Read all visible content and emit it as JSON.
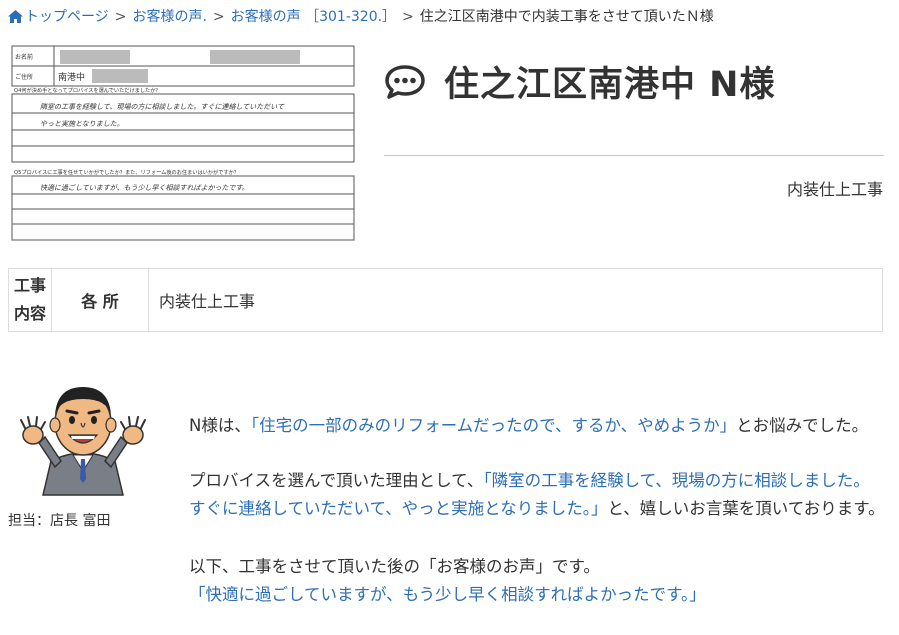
{
  "breadcrumb": {
    "home": "トップページ",
    "sep": ">",
    "items": [
      "お客様の声.",
      "お客様の声 ［301-320.］"
    ],
    "current": "住之江区南港中で内装工事をさせて頂いたＮ様"
  },
  "survey": {
    "name_label": "お名前",
    "address_label": "ご住所",
    "address_value": "南港中",
    "q4": "Q4何が決め手となってプロバイスを選んでいただけましたか？",
    "a4_line1": "隣室の工事を経験して、現場の方に相談しました。すぐに連絡していただいて",
    "a4_line2": "やっと実施となりました。",
    "q5": "Q5プロバイスに工事を任せていかがでしたか？また、リフォーム後のお住まいはいかがですか？",
    "a5_line1": "快適に過ごしていますが、もう少し早く相談すればよかったです。"
  },
  "title": "住之江区南港中 N様",
  "category": "内装仕上工事",
  "work_table": {
    "header1": "工事内容",
    "header1_l1": "工事",
    "header1_l2": "内容",
    "header2": "各 所",
    "value": "内装仕上工事"
  },
  "staff": {
    "label": "担当：店長 富田"
  },
  "messages": {
    "p1_pre": "N様は、",
    "p1_quote": "「住宅の一部のみのリフォームだったので、するか、やめようか」",
    "p1_post": "とお悩みでした。",
    "p2_pre": "プロバイスを選んで頂いた理由として、",
    "p2_quote_l1": "「隣室の工事を経験して、現場の方に相談しました。",
    "p2_quote_l2": "すぐに連絡していただいて、やっと実施となりました。」",
    "p2_post": "と、嬉しいお言葉を頂いております。",
    "p3_l1": "以下、工事をさせて頂いた後の「お客様のお声」です。",
    "p3_quote": "「快適に過ごしていますが、もう少し早く相談すればよかったです。」"
  },
  "colors": {
    "link": "#2c6fb8",
    "text": "#333333",
    "rule": "#c8c8c8"
  }
}
